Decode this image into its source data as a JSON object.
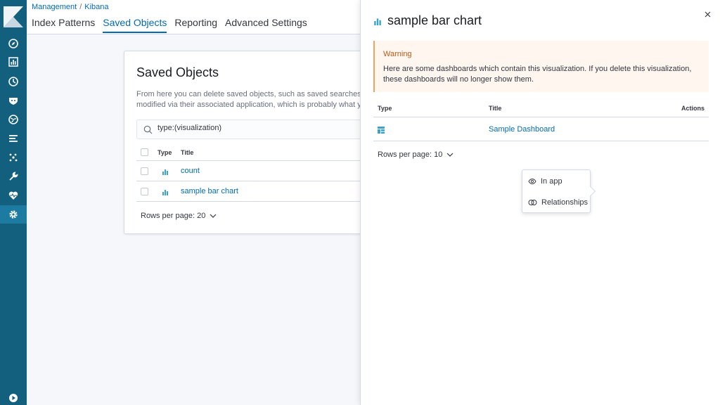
{
  "breadcrumbs": [
    "Management",
    "Kibana"
  ],
  "tabs": [
    "Index Patterns",
    "Saved Objects",
    "Reporting",
    "Advanced Settings"
  ],
  "panel": {
    "title": "Saved Objects",
    "description_line1": "From here you can delete saved objects, such as saved searches. You",
    "description_line2": "modified via their associated application, which is probably what you",
    "search_value": "type:(visualization)",
    "col_type": "Type",
    "col_title": "Title",
    "rows": [
      {
        "title": "count",
        "type_icon": "visualization-icon"
      },
      {
        "title": "sample bar chart",
        "type_icon": "visualization-icon"
      }
    ],
    "rows_per_page": "Rows per page: 20"
  },
  "flyout": {
    "title": "sample bar chart",
    "warning_title": "Warning",
    "warning_body": "Here are some dashboards which contain this visualization. If you delete this visualization, these dashboards will no longer show them.",
    "col_type": "Type",
    "col_title": "Title",
    "col_actions": "Actions",
    "row_title": "Sample Dashboard",
    "rows_per_page": "Rows per page: 10"
  },
  "popover": {
    "in_app": "In app",
    "relationships": "Relationships"
  },
  "colors": {
    "sidebar": "#125f7e",
    "link": "#006bb4",
    "viz": "#3ba3cb",
    "warning": "#bd5a16"
  }
}
